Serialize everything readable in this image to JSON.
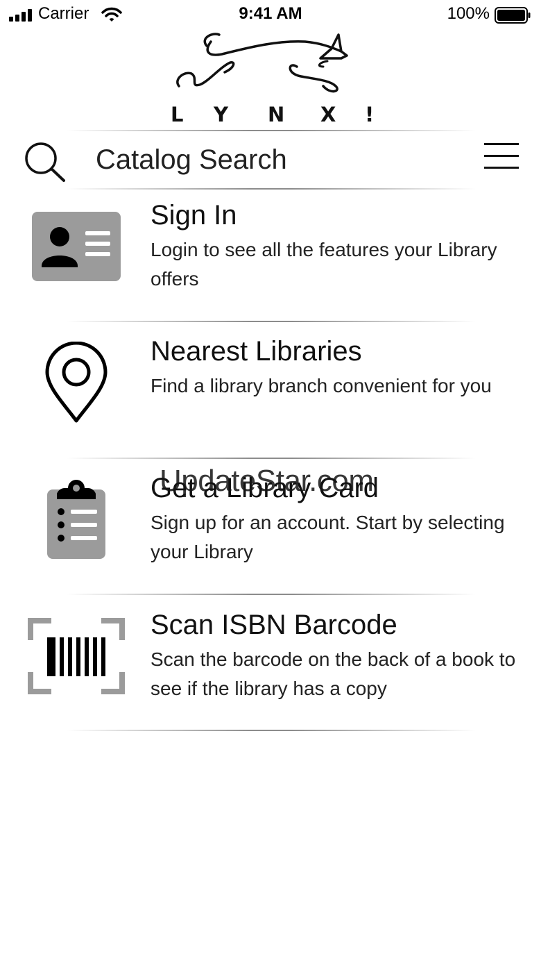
{
  "status_bar": {
    "carrier": "Carrier",
    "time": "9:41 AM",
    "battery": "100%"
  },
  "logo": {
    "letters": [
      "L",
      "Y",
      "N",
      "X",
      "!"
    ]
  },
  "search": {
    "placeholder": "Catalog Search",
    "value": ""
  },
  "menu": {
    "items": [
      {
        "title": "Sign In",
        "description": "Login to see all the features your Library offers",
        "icon": "id-card-icon"
      },
      {
        "title": "Nearest Libraries",
        "description": "Find a library branch convenient for you",
        "icon": "map-pin-icon"
      },
      {
        "title": "Get a Library Card",
        "description": "Sign up for an account. Start by selecting your Library",
        "icon": "clipboard-icon"
      },
      {
        "title": "Scan ISBN Barcode",
        "description": "Scan the barcode on the back of a book to see if the library has a copy",
        "icon": "barcode-scan-icon"
      }
    ]
  },
  "watermark": "UpdateStar.com",
  "colors": {
    "icon_gray": "#9b9b9b",
    "text": "#111111",
    "background": "#ffffff"
  }
}
